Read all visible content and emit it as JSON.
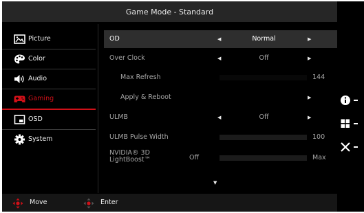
{
  "title": "Game Mode - Standard",
  "menu": [
    {
      "label": "Picture",
      "icon": "picture-icon"
    },
    {
      "label": "Color",
      "icon": "palette-icon"
    },
    {
      "label": "Audio",
      "icon": "speaker-icon"
    },
    {
      "label": "Gaming",
      "icon": "gamepad-icon",
      "active": true
    },
    {
      "label": "OSD",
      "icon": "osd-window-icon"
    },
    {
      "label": "System",
      "icon": "gear-icon"
    }
  ],
  "settings": {
    "od": {
      "label": "OD",
      "value": "Normal"
    },
    "over_clock": {
      "label": "Over Clock",
      "value": "Off"
    },
    "max_refresh": {
      "label": "Max Refresh",
      "value": "144"
    },
    "apply_reboot": {
      "label": "Apply & Reboot"
    },
    "ulmb": {
      "label": "ULMB",
      "value": "Off"
    },
    "ulmb_pulse_width": {
      "label": "ULMB Pulse Width",
      "value": "100"
    },
    "lightboost": {
      "label_line1": "NVIDIA® 3D",
      "label_line2": "LightBoost™",
      "state": "Off",
      "value": "Max"
    }
  },
  "footer": {
    "move_label": "Move",
    "enter_label": "Enter"
  },
  "colors": {
    "accent": "#d01018",
    "panel": "#000000",
    "selected_row": "#2e2e2e"
  }
}
